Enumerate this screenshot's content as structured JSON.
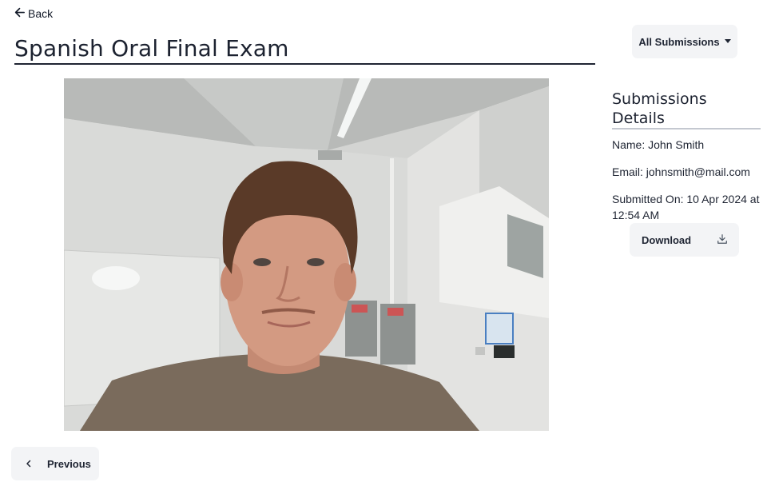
{
  "nav": {
    "back_label": "Back"
  },
  "page": {
    "title": "Spanish Oral Final Exam"
  },
  "filter": {
    "label": "All Submissions"
  },
  "details": {
    "title": "Submissions Details",
    "name": "Name: John Smith",
    "email": "Email: johnsmith@mail.com",
    "submitted_line1": "Submitted On: 10 Apr 2024 at",
    "submitted_line2": "12:54 AM"
  },
  "actions": {
    "download_label": "Download",
    "previous_label": "Previous"
  },
  "icons": {
    "back": "arrow-left-icon",
    "dropdown": "caret-down-icon",
    "download": "download-icon",
    "previous": "chevron-left-icon"
  },
  "colors": {
    "text": "#1f2533",
    "button_bg": "#f3f4f6",
    "underline_details": "#c4c8d0"
  }
}
